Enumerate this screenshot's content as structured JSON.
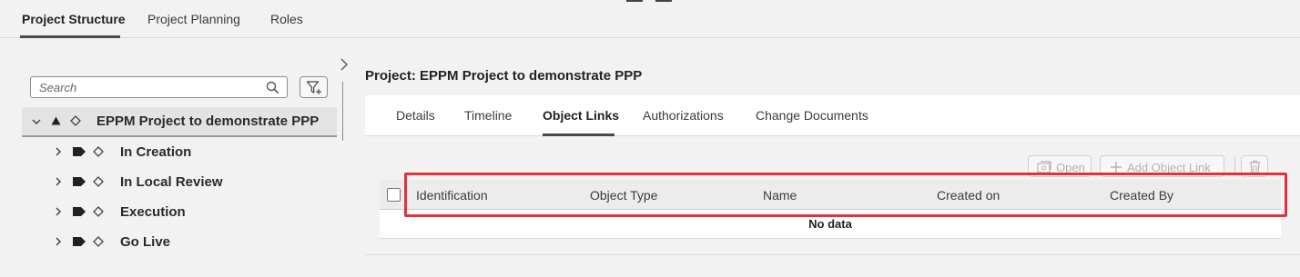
{
  "top_tabs": [
    {
      "label": "Project Structure",
      "active": true
    },
    {
      "label": "Project Planning",
      "active": false
    },
    {
      "label": "Roles",
      "active": false
    }
  ],
  "search": {
    "placeholder": "Search"
  },
  "tree": {
    "root": {
      "label": "EPPM Project to demonstrate PPP"
    },
    "children": [
      {
        "label": "In Creation"
      },
      {
        "label": "In Local Review"
      },
      {
        "label": "Execution"
      },
      {
        "label": "Go Live"
      }
    ]
  },
  "project": {
    "title": "Project: EPPM Project to demonstrate PPP"
  },
  "content_tabs": [
    {
      "label": "Details",
      "active": false
    },
    {
      "label": "Timeline",
      "active": false
    },
    {
      "label": "Object Links",
      "active": true
    },
    {
      "label": "Authorizations",
      "active": false
    },
    {
      "label": "Change Documents",
      "active": false
    }
  ],
  "toolbar": {
    "open_label": "Open",
    "add_label": "Add Object Link"
  },
  "table": {
    "columns": [
      "Identification",
      "Object Type",
      "Name",
      "Created on",
      "Created By"
    ],
    "empty_text": "No data"
  },
  "colors": {
    "highlight": "#e0343c",
    "tab_underline": "#4a4a4a"
  }
}
